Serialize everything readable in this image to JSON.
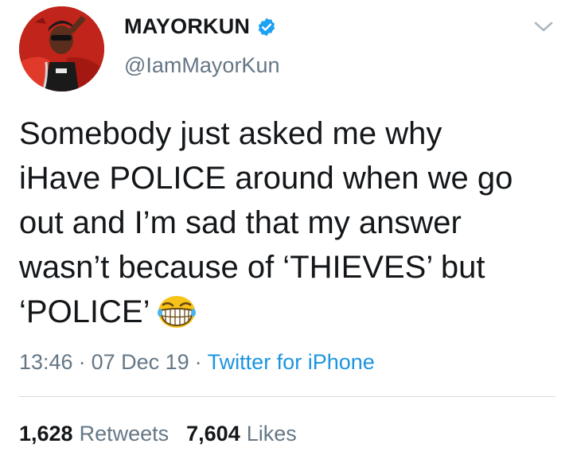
{
  "tweet": {
    "author": {
      "display_name": "MAYORKUN",
      "handle": "@IamMayorKun",
      "verified": true,
      "avatar_icon": "profile-photo"
    },
    "menu_icon": "chevron-down-icon",
    "text_lines": [
      "Somebody just asked me why",
      "iHave POLICE around when we go",
      "out and I’m sad that my answer",
      "wasn’t because of ‘THIEVES’ but",
      "‘POLICE’"
    ],
    "emoji_icon": "grinning-squinting-face-emoji",
    "time": "13:46",
    "date": "07 Dec 19",
    "separator": "·",
    "source": "Twitter for iPhone",
    "retweets": {
      "count": "1,628",
      "label": "Retweets"
    },
    "likes": {
      "count": "7,604",
      "label": "Likes"
    }
  },
  "colors": {
    "text": "#14171a",
    "secondary": "#657786",
    "link": "#1b95e0",
    "verified": "#1da1f2",
    "divider": "#d7dce0"
  }
}
